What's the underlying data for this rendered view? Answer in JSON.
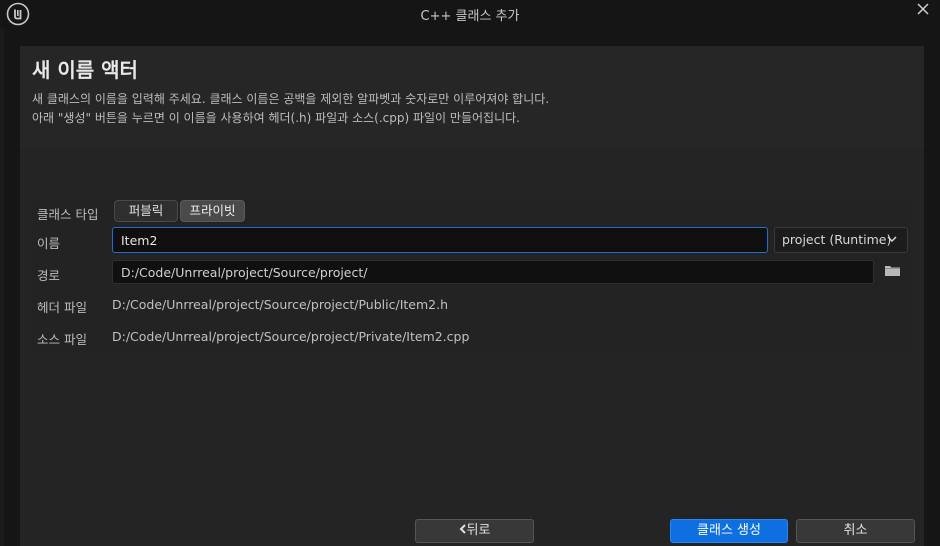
{
  "window": {
    "title": "C++ 클래스 추가"
  },
  "header": {
    "heading": "새 이름 액터",
    "description_line1": "새 클래스의 이름을 입력해 주세요. 클래스 이름은 공백을 제외한 알파벳과 숫자로만 이루어져야 합니다.",
    "description_line2": "아래 \"생성\" 버튼을 누르면 이 이름을 사용하여 헤더(.h) 파일과 소스(.cpp) 파일이 만들어집니다."
  },
  "form": {
    "class_type_label": "클래스 타입",
    "class_type_options": [
      "퍼블릭",
      "프라이빗"
    ],
    "class_type_selected": "프라이빗",
    "name_label": "이름",
    "name_value": "Item2",
    "module_select": "project (Runtime)",
    "path_label": "경로",
    "path_value": "D:/Code/Unrreal/project/Source/project/",
    "header_file_label": "헤더 파일",
    "header_file_value": "D:/Code/Unrreal/project/Source/project/Public/Item2.h",
    "source_file_label": "소스 파일",
    "source_file_value": "D:/Code/Unrreal/project/Source/project/Private/Item2.cpp"
  },
  "buttons": {
    "back": "뒤로",
    "create": "클래스 생성",
    "cancel": "취소"
  },
  "icons": {
    "logo": "unreal-logo-icon",
    "close": "close-icon",
    "chevron": "chevron-down-icon",
    "folder": "folder-icon",
    "back_arrow": "chevron-left-icon"
  },
  "colors": {
    "accent": "#0d6fe0",
    "background": "#151515",
    "panel": "#242424"
  }
}
